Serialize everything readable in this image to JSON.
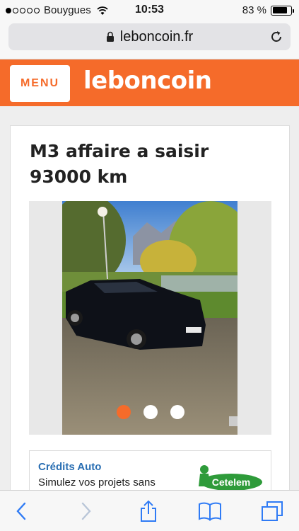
{
  "status_bar": {
    "carrier": "Bouygues",
    "time": "10:53",
    "battery": "83 %",
    "battery_level": 0.83
  },
  "address_bar": {
    "url": "leboncoin.fr",
    "lock_icon": "lock-icon",
    "reload_icon": "reload-icon"
  },
  "header": {
    "menu_label": "MENU",
    "logo_text": "leboncoin",
    "brand_color": "#f56b2a"
  },
  "listing": {
    "title": "M3 affaire a saisir 93000 km",
    "gallery": {
      "photo_count": 3,
      "current_index": 0
    }
  },
  "promo": {
    "title": "Crédits Auto",
    "text": "Simulez vos projets sans",
    "logo_text": "Cetelem"
  },
  "toolbar": {
    "back_icon": "chevron-left-icon",
    "forward_icon": "chevron-right-icon",
    "share_icon": "share-icon",
    "bookmarks_icon": "book-icon",
    "tabs_icon": "tabs-icon"
  }
}
